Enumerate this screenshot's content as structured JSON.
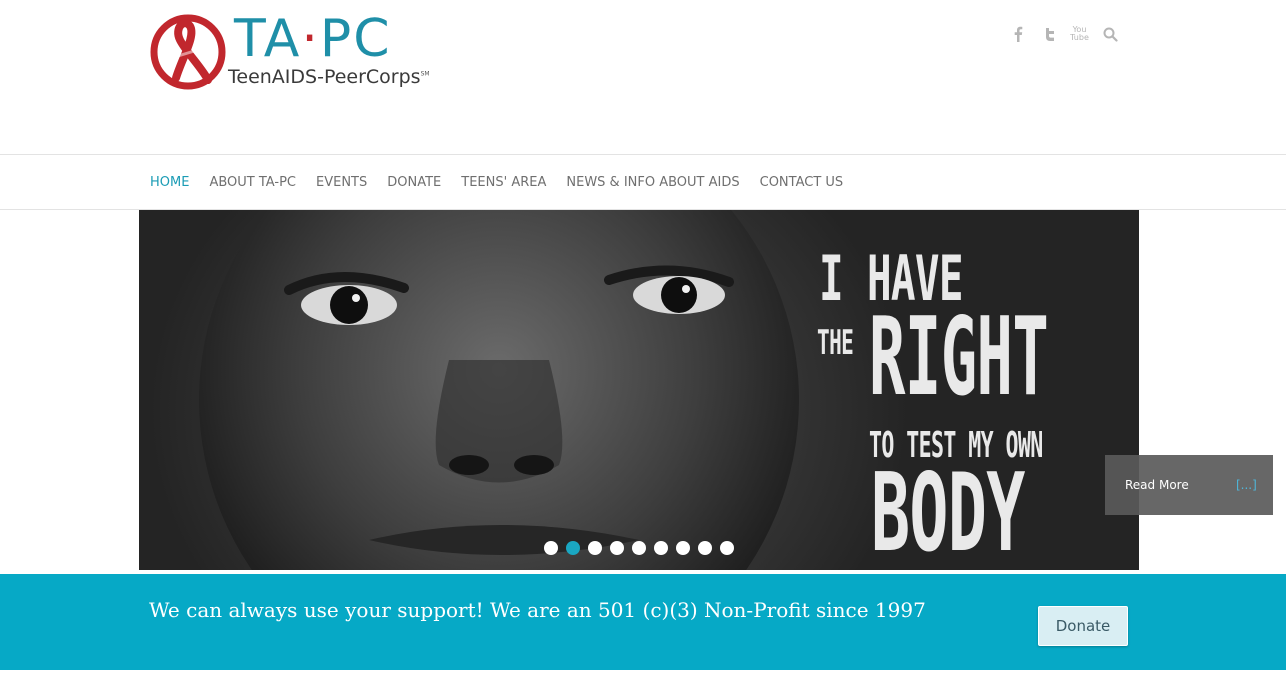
{
  "header": {
    "logo_title_left": "TA",
    "logo_title_dot": "·",
    "logo_title_right": "PC",
    "logo_subtitle": "TeenAIDS-PeerCorps",
    "logo_sm": "SM",
    "social": [
      {
        "icon": "facebook-icon"
      },
      {
        "icon": "twitter-icon"
      },
      {
        "icon": "youtube-icon",
        "label": "You Tube"
      },
      {
        "icon": "search-icon"
      }
    ]
  },
  "nav": {
    "items": [
      {
        "label": "HOME",
        "active": true
      },
      {
        "label": "ABOUT TA-PC"
      },
      {
        "label": "EVENTS"
      },
      {
        "label": "DONATE"
      },
      {
        "label": "TEENS' AREA"
      },
      {
        "label": "NEWS & INFO ABOUT AIDS"
      },
      {
        "label": "CONTACT US"
      }
    ]
  },
  "hero": {
    "slogan": {
      "line1": "I HAVE",
      "line2a": "THE",
      "line2b": "RIGHT",
      "line3": "TO TEST MY OWN",
      "line4": "BODY"
    },
    "slide_count": 9,
    "active_slide": 2,
    "read_more": "Read More",
    "read_more_link": "[...]"
  },
  "support": {
    "text": "We can always use your support! We are an 501 (c)(3) Non-Profit since 1997",
    "donate_label": "Donate"
  },
  "colors": {
    "brand_teal": "#1f8fa8",
    "brand_red": "#c1272d",
    "band_bg": "#06a9c6",
    "nav_active": "#1b9cb5"
  }
}
